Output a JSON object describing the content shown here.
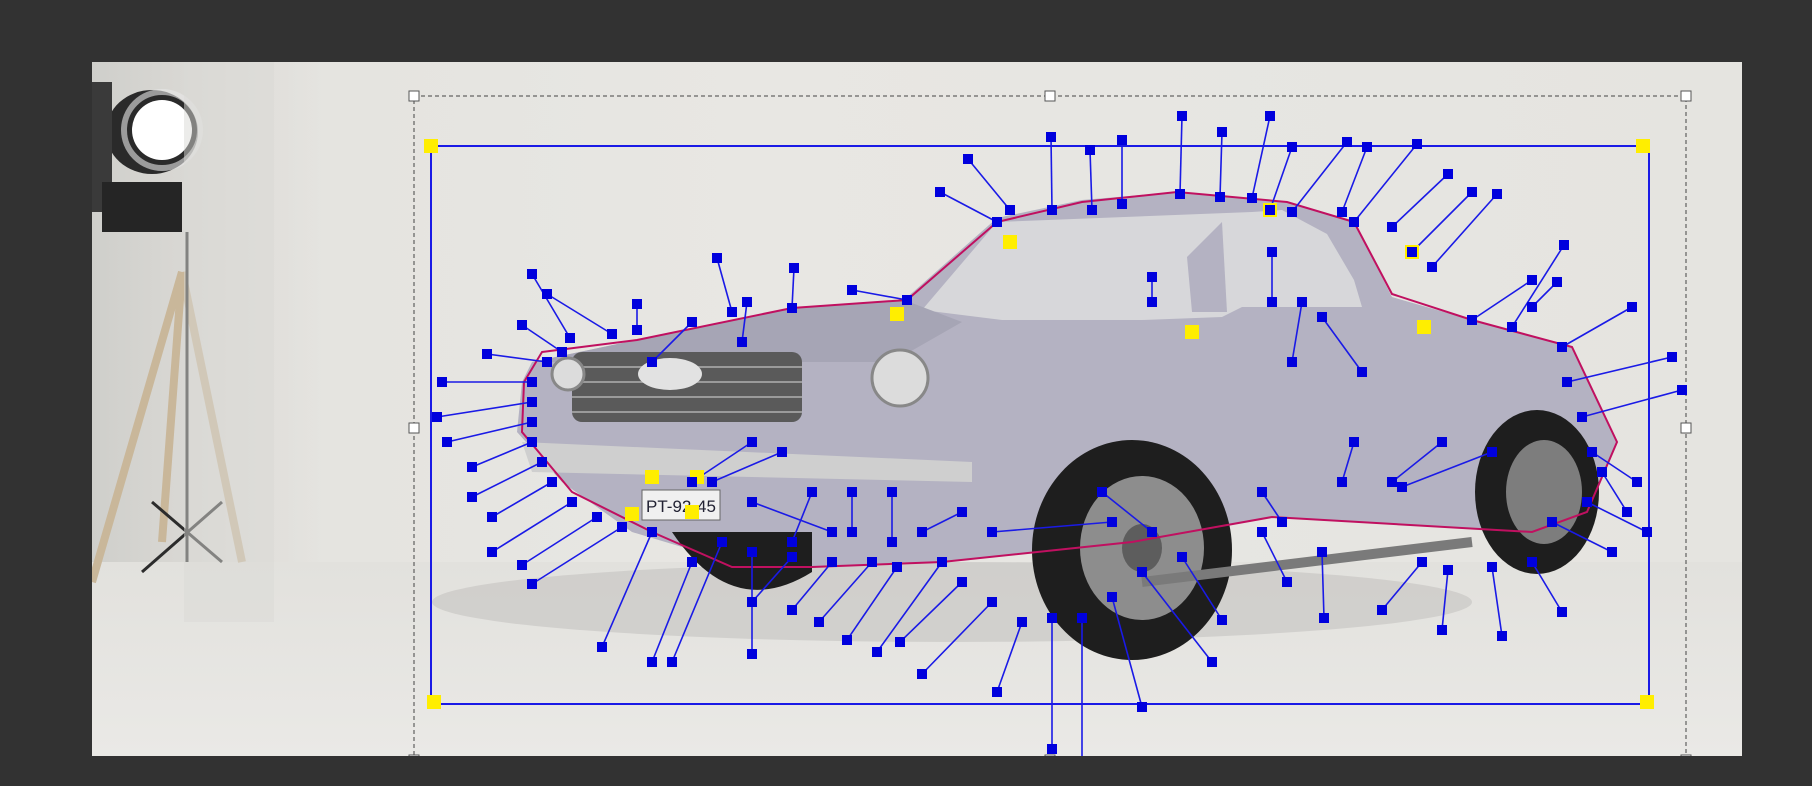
{
  "window": {
    "background": "#323232"
  },
  "canvas": {
    "image_subject": "classic-coupe-photo"
  },
  "car": {
    "license_plate": "PT-92-45",
    "body_color": "#b4b2c2"
  },
  "overlay": {
    "handle_color": "#0000dd",
    "anchor_color": "#ffee00",
    "line_color": "#1a1ae6",
    "outline_color": "#c01060",
    "selection_color": "#444444"
  },
  "icons": [
    "studio-light-icon",
    "tripod-icon",
    "resize-handle-icon"
  ]
}
